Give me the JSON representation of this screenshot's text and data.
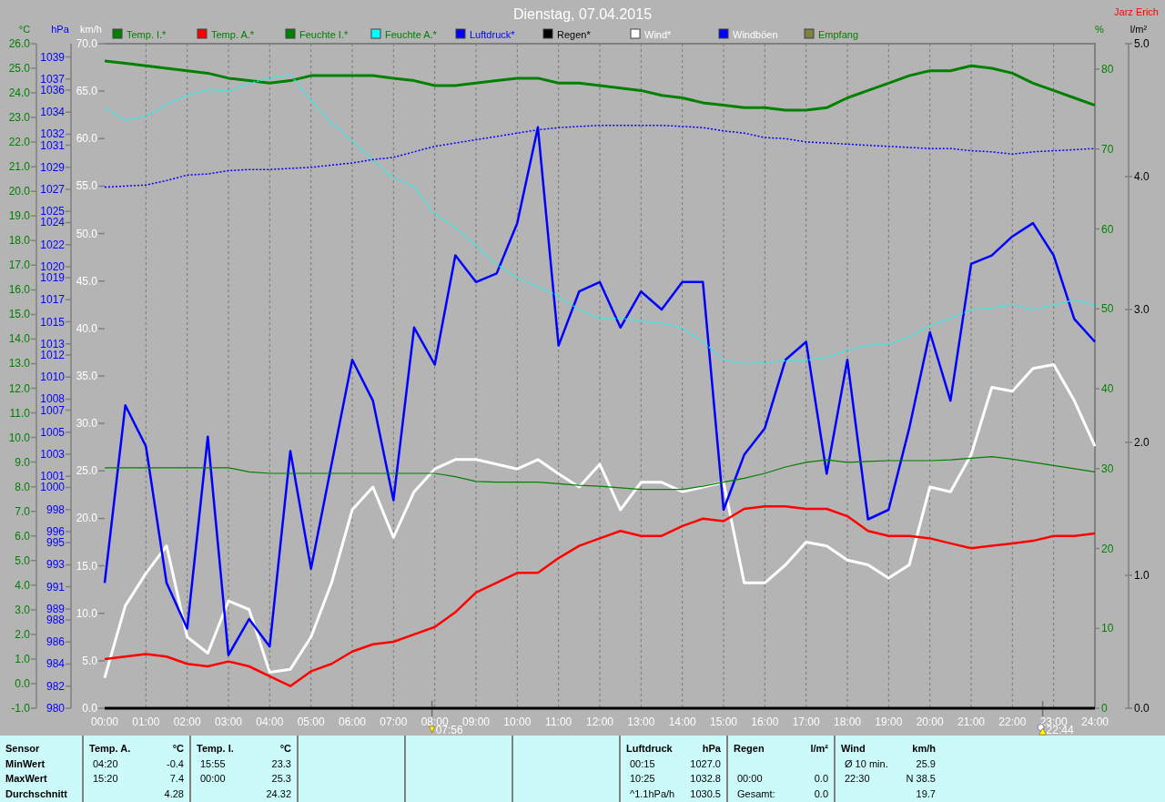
{
  "window": {
    "title": "Dienstag, 07.04.2015",
    "user": "Jarz Erich"
  },
  "charts": [
    {
      "chart_data": {
        "type": "line",
        "ylabel": "km/h",
        "xlim": [
          0,
          24
        ],
        "ylim": [
          0,
          70
        ],
        "grid": true,
        "legend": "top",
        "x": [
          0,
          0.5,
          1,
          1.5,
          2,
          2.5,
          3,
          3.5,
          4,
          4.5,
          5,
          5.5,
          6,
          6.5,
          7,
          7.5,
          8,
          8.5,
          9,
          9.5,
          10,
          10.5,
          11,
          11.5,
          12,
          12.5,
          13,
          13.5,
          14,
          14.5,
          15,
          15.5,
          16,
          16.5,
          17,
          17.5,
          18,
          18.5,
          19,
          19.5,
          20,
          20.5,
          21,
          21.5,
          22,
          22.5,
          23,
          23.5,
          24
        ],
        "xticks": [
          {
            "value": 0,
            "label": "00:00"
          },
          {
            "value": 1,
            "label": "01:00"
          },
          {
            "value": 2,
            "label": "02:00"
          },
          {
            "value": 3,
            "label": "03:00"
          },
          {
            "value": 4,
            "label": "04:00"
          },
          {
            "value": 5,
            "label": "05:00"
          },
          {
            "value": 6,
            "label": "06:00"
          },
          {
            "value": 7,
            "label": "07:00"
          },
          {
            "value": 8,
            "label": "08:00"
          },
          {
            "value": 9,
            "label": "09:00"
          },
          {
            "value": 10,
            "label": "10:00"
          },
          {
            "value": 11,
            "label": "11:00"
          },
          {
            "value": 12,
            "label": "12:00"
          },
          {
            "value": 13,
            "label": "13:00"
          },
          {
            "value": 14,
            "label": "14:00"
          },
          {
            "value": 15,
            "label": "15:00"
          },
          {
            "value": 16,
            "label": "16:00"
          },
          {
            "value": 17,
            "label": "17:00"
          },
          {
            "value": 18,
            "label": "18:00"
          },
          {
            "value": 19,
            "label": "19:00"
          },
          {
            "value": 20,
            "label": "20:00"
          },
          {
            "value": 21,
            "label": "21:00"
          },
          {
            "value": 22,
            "label": "22:00"
          },
          {
            "value": 23,
            "label": "23:00"
          },
          {
            "value": 24,
            "label": "24:00"
          }
        ],
        "yticks": [
          {
            "value": 0,
            "label": "0.0"
          },
          {
            "value": 5,
            "label": "5.0"
          },
          {
            "value": 10,
            "label": "10.0"
          },
          {
            "value": 15,
            "label": "15.0"
          },
          {
            "value": 20,
            "label": "20.0"
          },
          {
            "value": 25,
            "label": "25.0"
          },
          {
            "value": 30,
            "label": "30.0"
          },
          {
            "value": 35,
            "label": "35.0"
          },
          {
            "value": 40,
            "label": "40.0"
          },
          {
            "value": 45,
            "label": "45.0"
          },
          {
            "value": 50,
            "label": "50.0"
          },
          {
            "value": 55,
            "label": "55.0"
          },
          {
            "value": 60,
            "label": "60.0"
          },
          {
            "value": 65,
            "label": "65.0"
          },
          {
            "value": 70,
            "label": "70.0"
          }
        ],
        "series": [
          {
            "name": "Wind*",
            "color": "#ffffff",
            "values": [
              3.2,
              10.8,
              14.2,
              17.1,
              7.5,
              5.8,
              11.3,
              10.4,
              3.8,
              4.1,
              7.5,
              13.2,
              20.9,
              23.3,
              18.0,
              22.8,
              25.2,
              26.2,
              26.2,
              25.7,
              25.2,
              26.2,
              24.7,
              23.3,
              25.7,
              20.9,
              23.8,
              23.8,
              22.8,
              23.3,
              23.8,
              13.2,
              13.2,
              15.1,
              17.5,
              17.1,
              15.6,
              15.1,
              13.7,
              15.1,
              23.3,
              22.8,
              26.7,
              33.8,
              33.4,
              35.8,
              36.2,
              32.4,
              27.6
            ]
          },
          {
            "name": "Windböen",
            "color": "#0000ff",
            "values": [
              13.2,
              31.9,
              27.6,
              13.2,
              8.4,
              28.6,
              5.6,
              9.4,
              6.5,
              27.1,
              14.7,
              25.7,
              36.7,
              32.4,
              21.9,
              40.1,
              36.2,
              47.7,
              44.9,
              45.8,
              51.1,
              61.2,
              38.2,
              43.9,
              44.9,
              40.1,
              43.9,
              42.0,
              44.9,
              44.9,
              20.9,
              26.7,
              29.5,
              36.7,
              38.6,
              24.7,
              36.7,
              19.9,
              20.9,
              29.5,
              39.6,
              32.4,
              46.8,
              47.7,
              49.7,
              51.1,
              47.7,
              41.0,
              38.6
            ]
          }
        ],
        "annotations": [
          "07:56",
          "22:44"
        ]
      }
    },
    {
      "chart_data": {
        "type": "line",
        "ylabel": "°C",
        "xlim": [
          0,
          24
        ],
        "ylim": [
          -1,
          26
        ],
        "x": [
          0,
          0.5,
          1,
          1.5,
          2,
          2.5,
          3,
          3.5,
          4,
          4.5,
          5,
          5.5,
          6,
          6.5,
          7,
          7.5,
          8,
          8.5,
          9,
          9.5,
          10,
          10.5,
          11,
          11.5,
          12,
          12.5,
          13,
          13.5,
          14,
          14.5,
          15,
          15.5,
          16,
          16.5,
          17,
          17.5,
          18,
          18.5,
          19,
          19.5,
          20,
          20.5,
          21,
          21.5,
          22,
          22.5,
          23,
          23.5,
          24
        ],
        "yticks": [
          {
            "value": -1,
            "label": "-1.0"
          },
          {
            "value": 0,
            "label": "0.0"
          },
          {
            "value": 1,
            "label": "1.0"
          },
          {
            "value": 2,
            "label": "2.0"
          },
          {
            "value": 3,
            "label": "3.0"
          },
          {
            "value": 4,
            "label": "4.0"
          },
          {
            "value": 5,
            "label": "5.0"
          },
          {
            "value": 6,
            "label": "6.0"
          },
          {
            "value": 7,
            "label": "7.0"
          },
          {
            "value": 8,
            "label": "8.0"
          },
          {
            "value": 9,
            "label": "9.0"
          },
          {
            "value": 10,
            "label": "10.0"
          },
          {
            "value": 11,
            "label": "11.0"
          },
          {
            "value": 12,
            "label": "12.0"
          },
          {
            "value": 13,
            "label": "13.0"
          },
          {
            "value": 14,
            "label": "14.0"
          },
          {
            "value": 15,
            "label": "15.0"
          },
          {
            "value": 16,
            "label": "16.0"
          },
          {
            "value": 17,
            "label": "17.0"
          },
          {
            "value": 18,
            "label": "18.0"
          },
          {
            "value": 19,
            "label": "19.0"
          },
          {
            "value": 20,
            "label": "20.0"
          },
          {
            "value": 21,
            "label": "21.0"
          },
          {
            "value": 22,
            "label": "22.0"
          },
          {
            "value": 23,
            "label": "23.0"
          },
          {
            "value": 24,
            "label": "24.0"
          },
          {
            "value": 25,
            "label": "25.0"
          },
          {
            "value": 26,
            "label": "26.0"
          }
        ],
        "series": [
          {
            "name": "Temp. I.*",
            "color": "#008000",
            "values": [
              25.3,
              25.2,
              25.1,
              25.0,
              24.9,
              24.8,
              24.6,
              24.5,
              24.4,
              24.5,
              24.7,
              24.7,
              24.7,
              24.7,
              24.6,
              24.5,
              24.3,
              24.3,
              24.4,
              24.5,
              24.6,
              24.6,
              24.4,
              24.4,
              24.3,
              24.2,
              24.1,
              23.9,
              23.8,
              23.6,
              23.5,
              23.4,
              23.4,
              23.3,
              23.3,
              23.4,
              23.8,
              24.1,
              24.4,
              24.7,
              24.9,
              24.9,
              25.1,
              25.0,
              24.8,
              24.4,
              24.1,
              23.8,
              23.5
            ]
          },
          {
            "name": "Temp. A.*",
            "color": "#ff0000",
            "values": [
              1.0,
              1.1,
              1.2,
              1.1,
              0.8,
              0.7,
              0.9,
              0.7,
              0.3,
              -0.1,
              0.5,
              0.8,
              1.3,
              1.6,
              1.7,
              2.0,
              2.3,
              2.9,
              3.7,
              4.1,
              4.5,
              4.5,
              5.1,
              5.6,
              5.9,
              6.2,
              6.0,
              6.0,
              6.4,
              6.7,
              6.6,
              7.1,
              7.2,
              7.2,
              7.1,
              7.1,
              6.8,
              6.2,
              6.0,
              6.0,
              5.9,
              5.7,
              5.5,
              5.6,
              5.7,
              5.8,
              6.0,
              6.0,
              6.1
            ]
          }
        ]
      }
    },
    {
      "chart_data": {
        "type": "line",
        "ylabel": "%",
        "xlim": [
          0,
          24
        ],
        "ylim": [
          0,
          83.2
        ],
        "x": [
          0,
          0.5,
          1,
          1.5,
          2,
          2.5,
          3,
          3.5,
          4,
          4.5,
          5,
          5.5,
          6,
          6.5,
          7,
          7.5,
          8,
          8.5,
          9,
          9.5,
          10,
          10.5,
          11,
          11.5,
          12,
          12.5,
          13,
          13.5,
          14,
          14.5,
          15,
          15.5,
          16,
          16.5,
          17,
          17.5,
          18,
          18.5,
          19,
          19.5,
          20,
          20.5,
          21,
          21.5,
          22,
          22.5,
          23,
          23.5,
          24
        ],
        "yticks": [
          0,
          10,
          20,
          30,
          40,
          50,
          60,
          70,
          80
        ],
        "series": [
          {
            "name": "Feuchte I.*",
            "color": "#008000",
            "values": [
              30.1,
              30.1,
              30.1,
              30.1,
              30.1,
              30.1,
              30.1,
              29.6,
              29.4,
              29.4,
              29.4,
              29.4,
              29.4,
              29.4,
              29.4,
              29.4,
              29.4,
              29.0,
              28.4,
              28.3,
              28.3,
              28.3,
              28.1,
              27.9,
              27.8,
              27.6,
              27.4,
              27.4,
              27.4,
              27.8,
              28.3,
              28.8,
              29.4,
              30.2,
              30.8,
              31.1,
              30.8,
              30.9,
              31.0,
              31.0,
              31.0,
              31.1,
              31.3,
              31.5,
              31.2,
              30.8,
              30.4,
              30.0,
              29.6
            ]
          },
          {
            "name": "Feuchte A.*",
            "color": "#00ffff",
            "line_style": "dotted",
            "values": [
              75.2,
              73.6,
              74.1,
              75.6,
              76.7,
              77.5,
              77.3,
              78.2,
              78.9,
              79.3,
              76.1,
              73.3,
              71.0,
              68.7,
              66.4,
              65.3,
              61.9,
              60.2,
              57.9,
              55.6,
              53.9,
              52.8,
              51.6,
              49.9,
              48.8,
              48.8,
              48.5,
              48.2,
              47.6,
              45.9,
              43.6,
              43.1,
              43.3,
              43.5,
              43.6,
              43.9,
              44.8,
              45.4,
              45.6,
              46.5,
              47.9,
              48.8,
              49.9,
              50.1,
              50.5,
              49.9,
              50.5,
              51.1,
              50.5
            ]
          },
          {
            "name": "Empfang",
            "color": "#808040",
            "values": [
              null,
              null,
              null,
              null,
              null,
              null,
              null,
              null,
              null,
              null,
              null,
              null,
              null,
              null,
              null,
              null,
              null,
              null,
              null,
              null,
              null,
              null,
              null,
              null,
              null,
              null,
              null,
              null,
              null,
              null,
              null,
              null,
              null,
              null,
              null,
              null,
              null,
              null,
              null,
              null,
              null,
              null,
              null,
              null,
              null,
              null,
              null,
              null,
              null
            ]
          }
        ]
      }
    },
    {
      "chart_data": {
        "type": "line",
        "ylabel": "hPa",
        "xlim": [
          0,
          24
        ],
        "ylim": [
          980,
          1040.2
        ],
        "x": [
          0,
          0.5,
          1,
          1.5,
          2,
          2.5,
          3,
          3.5,
          4,
          4.5,
          5,
          5.5,
          6,
          6.5,
          7,
          7.5,
          8,
          8.5,
          9,
          9.5,
          10,
          10.5,
          11,
          11.5,
          12,
          12.5,
          13,
          13.5,
          14,
          14.5,
          15,
          15.5,
          16,
          16.5,
          17,
          17.5,
          18,
          18.5,
          19,
          19.5,
          20,
          20.5,
          21,
          21.5,
          22,
          22.5,
          23,
          23.5,
          24
        ],
        "yticks": [
          980,
          982,
          984,
          986,
          988,
          989,
          991,
          993,
          995,
          996,
          998,
          1000,
          1001,
          1003,
          1005,
          1007,
          1008,
          1010,
          1012,
          1013,
          1015,
          1017,
          1019,
          1020,
          1022,
          1024,
          1025,
          1027,
          1029,
          1031,
          1032,
          1034,
          1036,
          1037,
          1039
        ],
        "series": [
          {
            "name": "Luftdruck*",
            "color": "#0000ff",
            "line_style": "dotted",
            "values": [
              1027.2,
              1027.3,
              1027.4,
              1027.8,
              1028.3,
              1028.4,
              1028.7,
              1028.8,
              1028.8,
              1028.9,
              1029.0,
              1029.2,
              1029.4,
              1029.7,
              1029.9,
              1030.4,
              1030.9,
              1031.2,
              1031.5,
              1031.8,
              1032.1,
              1032.4,
              1032.6,
              1032.7,
              1032.8,
              1032.8,
              1032.8,
              1032.8,
              1032.7,
              1032.6,
              1032.3,
              1032.1,
              1031.7,
              1031.6,
              1031.3,
              1031.2,
              1031.1,
              1031.0,
              1030.9,
              1030.8,
              1030.7,
              1030.7,
              1030.5,
              1030.4,
              1030.2,
              1030.4,
              1030.5,
              1030.6,
              1030.7
            ]
          }
        ]
      }
    },
    {
      "chart_data": {
        "type": "line",
        "ylabel": "l/m²",
        "xlim": [
          0,
          24
        ],
        "ylim": [
          0,
          5
        ],
        "x": [
          0,
          0.5,
          1,
          1.5,
          2,
          2.5,
          3,
          3.5,
          4,
          4.5,
          5,
          5.5,
          6,
          6.5,
          7,
          7.5,
          8,
          8.5,
          9,
          9.5,
          10,
          10.5,
          11,
          11.5,
          12,
          12.5,
          13,
          13.5,
          14,
          14.5,
          15,
          15.5,
          16,
          16.5,
          17,
          17.5,
          18,
          18.5,
          19,
          19.5,
          20,
          20.5,
          21,
          21.5,
          22,
          22.5,
          23,
          23.5,
          24
        ],
        "yticks": [
          {
            "value": 0,
            "label": "0.0"
          },
          {
            "value": 1,
            "label": "1.0"
          },
          {
            "value": 2,
            "label": "2.0"
          },
          {
            "value": 3,
            "label": "3.0"
          },
          {
            "value": 4,
            "label": "4.0"
          },
          {
            "value": 5,
            "label": "5.0"
          }
        ],
        "series": [
          {
            "name": "Regen*",
            "color": "#000000",
            "values": [
              0,
              0,
              0,
              0,
              0,
              0,
              0,
              0,
              0,
              0,
              0,
              0,
              0,
              0,
              0,
              0,
              0,
              0,
              0,
              0,
              0,
              0,
              0,
              0,
              0,
              0,
              0,
              0,
              0,
              0,
              0,
              0,
              0,
              0,
              0,
              0,
              0,
              0,
              0,
              0,
              0,
              0,
              0,
              0,
              0,
              0,
              0,
              0,
              0
            ]
          }
        ]
      }
    }
  ],
  "stats": {
    "row_labels": [
      "Sensor",
      "MinWert",
      "MaxWert",
      "Durchschnitt"
    ],
    "sections": [
      {
        "kind": "sensor",
        "title": "Temp. A.",
        "unit": "°C",
        "rows": [
          {
            "time": "04:20",
            "value": "-0.4"
          },
          {
            "time": "15:20",
            "value": "7.4"
          },
          {
            "value": "4.28"
          }
        ]
      },
      {
        "kind": "sensor",
        "title": "Temp. I.",
        "unit": "°C",
        "rows": [
          {
            "time": "15:55",
            "value": "23.3"
          },
          {
            "time": "00:00",
            "value": "25.3"
          },
          {
            "value": "24.32"
          }
        ]
      },
      {
        "kind": "empty"
      },
      {
        "kind": "empty"
      },
      {
        "kind": "empty"
      },
      {
        "kind": "sensor",
        "title": "Luftdruck",
        "unit": "hPa",
        "rows": [
          {
            "time": "00:15",
            "value": "1027.0"
          },
          {
            "time": "10:25",
            "value": "1032.8"
          },
          {
            "time": "^1.1hPa/h",
            "value": "1030.5"
          }
        ]
      },
      {
        "kind": "sensor",
        "title": "Regen",
        "unit": "l/m²",
        "rows": [
          null,
          {
            "time": "00:00",
            "value": "0.0"
          },
          {
            "time": "Gesamt:",
            "value": "0.0"
          }
        ]
      },
      {
        "kind": "sensor",
        "title": "Wind",
        "unit": "km/h",
        "rows": [
          {
            "time": "Ø 10 min.",
            "value": "25.9"
          },
          {
            "time": "22:30",
            "value": "N 38.5"
          },
          {
            "value": "19.7"
          }
        ]
      }
    ]
  }
}
